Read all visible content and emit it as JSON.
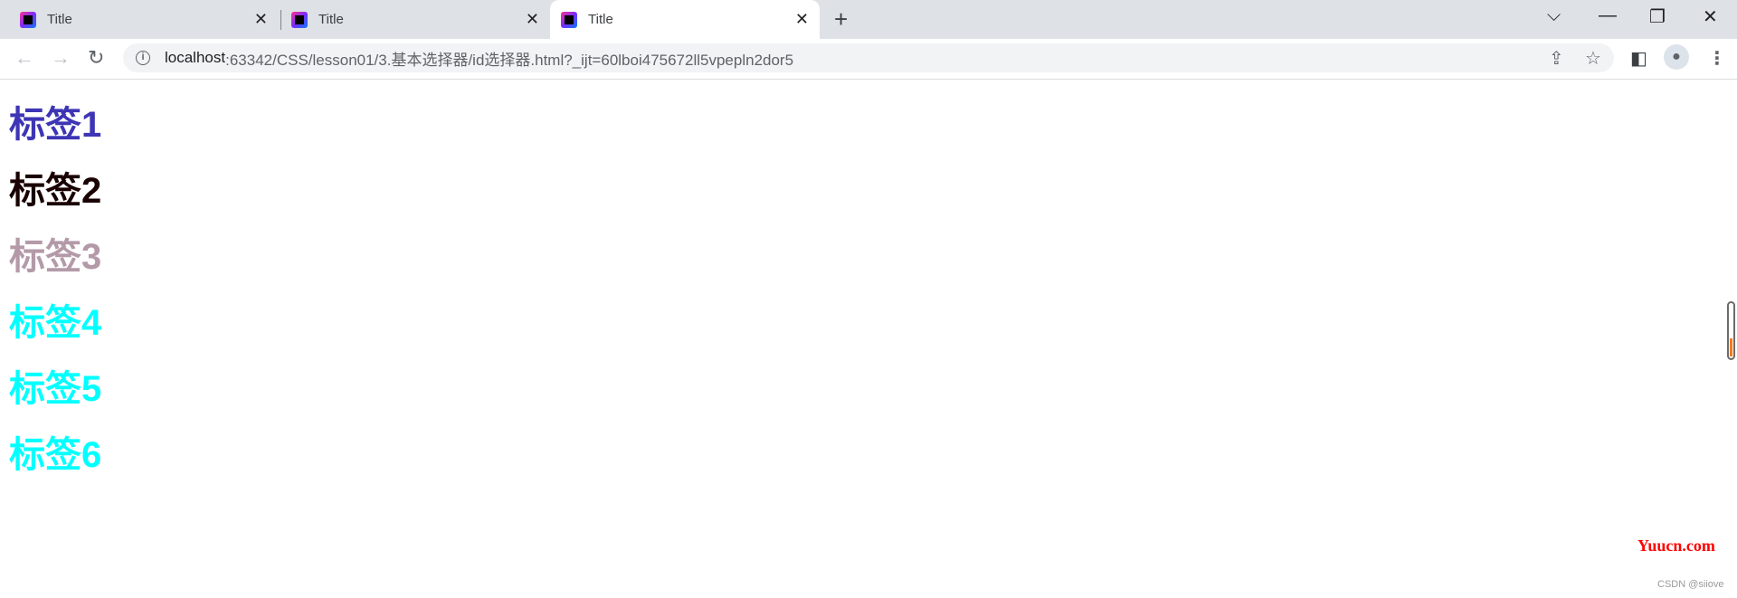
{
  "tabs": [
    {
      "title": "Title",
      "active": false
    },
    {
      "title": "Title",
      "active": false
    },
    {
      "title": "Title",
      "active": true
    }
  ],
  "icons": {
    "favicon": "jetbrains-icon",
    "close": "✕",
    "new_tab": "+",
    "tab_search": "⌵",
    "minimize": "—",
    "restore": "❐",
    "close_window": "✕",
    "back": "←",
    "forward": "→",
    "reload": "↻",
    "info": "i",
    "share": "⇪",
    "star": "☆",
    "side_panel": "◧",
    "profile": "●",
    "menu": "⋮"
  },
  "address": {
    "host": "localhost",
    "path": ":63342/CSS/lesson01/3.基本选择器/id选择器.html?_ijt=60lboi475672ll5vpepln2dor5"
  },
  "headings": [
    {
      "text": "标签1",
      "color": "#3d35b5"
    },
    {
      "text": "标签2",
      "color": "#1a0000"
    },
    {
      "text": "标签3",
      "color": "#b49aa8"
    },
    {
      "text": "标签4",
      "color": "#00ffff"
    },
    {
      "text": "标签5",
      "color": "#00ffff"
    },
    {
      "text": "标签6",
      "color": "#00ffff"
    }
  ],
  "watermarks": {
    "site": "Yuucn.com",
    "author": "CSDN @siiove"
  }
}
